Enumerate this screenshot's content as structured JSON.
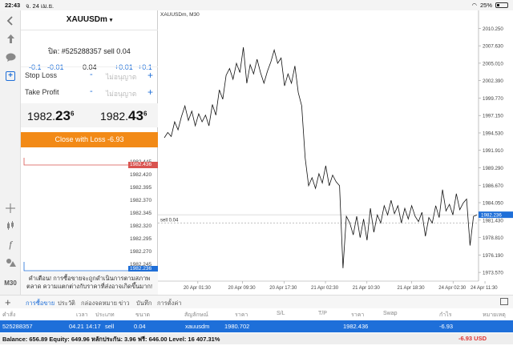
{
  "status": {
    "time": "22:43",
    "date": "จ. 24 เม.ย.",
    "battery": "25%"
  },
  "toolbar": {
    "tools": [
      "back-icon",
      "trade-icon",
      "chat-icon",
      "new-order-icon",
      "crosshair-icon",
      "candles-icon",
      "indicator-icon",
      "objects-icon",
      "timeframe"
    ],
    "timeframe": "M30",
    "indicator_glyph": "f"
  },
  "order": {
    "symbol": "XAUUSDm",
    "symbol_caret": "▾",
    "title": "ปิด: #525288357 sell 0.04",
    "steps": {
      "m2": "-0.1",
      "m1": "-0.01",
      "volume": "0.04",
      "p1": "+0.01",
      "p2": "+0.1"
    },
    "stop_loss": {
      "label": "Stop Loss",
      "minus": "-",
      "placeholder": "ไม่อนุญาต",
      "plus": "+"
    },
    "take_profit": {
      "label": "Take Profit",
      "minus": "-",
      "placeholder": "ไม่อนุญาต",
      "plus": "+"
    },
    "bid": {
      "main": "1982.",
      "big": "23",
      "sup": "6"
    },
    "ask": {
      "main": "1982.",
      "big": "43",
      "sup": "6"
    },
    "close_button": "Close with Loss -6.93",
    "warning": "คำเตือน! การซื้อขายจะถูกดำเนินการตามสภาพตลาด ความแตกต่างกับราคาที่ส่งอาจเกิดขึ้นมาก!"
  },
  "mini_chart": {
    "levels": [
      "1982.445",
      "1982.420",
      "1982.395",
      "1982.370",
      "1982.345",
      "1982.320",
      "1982.295",
      "1982.270",
      "1982.245"
    ],
    "ask_tag": "1982.436",
    "bid_tag": "1982.236",
    "ask_color": "#d9534f",
    "bid_color": "#1f6fd8"
  },
  "chart": {
    "title": "XAUUSDm, M30",
    "price_tag": "1982.236",
    "sell_label": "sell 0.04",
    "tag_color": "#1f6fd8"
  },
  "chart_data": {
    "type": "line",
    "title": "XAUUSDm, M30",
    "yticks": [
      "2010.250",
      "2007.630",
      "2005.010",
      "2002.390",
      "1999.770",
      "1997.150",
      "1994.530",
      "1991.910",
      "1989.290",
      "1986.670",
      "1984.050",
      "1981.430",
      "1978.810",
      "1976.190",
      "1973.570"
    ],
    "xticks": [
      "20 Apr 01:30",
      "20 Apr 09:30",
      "20 Apr 17:30",
      "21 Apr 02:30",
      "21 Apr 10:30",
      "21 Apr 18:30",
      "24 Apr 02:30",
      "24 Apr 11:30"
    ],
    "ylim": [
      1972.5,
      2011.5
    ],
    "sell_level": 1981.0,
    "current_price": 1982.236,
    "values": [
      1993.8,
      1994.6,
      1994.0,
      1996.2,
      1995.0,
      1997.0,
      1998.6,
      1996.4,
      1997.8,
      1995.6,
      1997.4,
      1996.2,
      1997.2,
      1995.6,
      1998.8,
      1997.2,
      2001.0,
      1999.6,
      2003.2,
      2004.2,
      2002.6,
      2005.0,
      2003.6,
      2007.4,
      2002.0,
      2004.8,
      2003.4,
      2005.6,
      2003.6,
      2002.0,
      2003.8,
      2005.2,
      2007.0,
      2005.0,
      2005.8,
      2001.6,
      2003.4,
      2002.0,
      2004.6,
      2000.6,
      1998.6,
      1990.8,
      1986.6,
      1987.8,
      1986.2,
      1988.4,
      1987.0,
      1989.6,
      1986.6,
      1988.2,
      1987.2,
      1986.6,
      1974.2,
      1982.0,
      1981.0,
      1979.2,
      1982.0,
      1978.8,
      1981.6,
      1978.4,
      1983.2,
      1979.6,
      1982.2,
      1981.0,
      1983.6,
      1982.2,
      1984.4,
      1982.4,
      1983.6,
      1981.0,
      1983.2,
      1981.6,
      1983.6,
      1982.0,
      1981.2,
      1982.6,
      1979.0,
      1981.8,
      1981.0,
      1983.6,
      1981.8,
      1986.0,
      1982.8,
      1983.8,
      1982.2,
      1985.4,
      1983.0,
      1984.0,
      1984.6,
      1977.6,
      1982.0,
      1982.2
    ]
  },
  "terminal": {
    "tabs": [
      "การซื้อขาย",
      "ประวัติ",
      "กล่องจดหมาย",
      "ข่าว",
      "บันทึก",
      "การตั้งค่า"
    ],
    "headers": [
      "คำสั่ง",
      "เวลา",
      "ประเภท",
      "ขนาด",
      "สัญลักษณ์",
      "ราคา",
      "S/L",
      "T/P",
      "ราคา",
      "Swap",
      "กำไร",
      "หมายเหตุ"
    ],
    "row": {
      "order": "525288357",
      "time": "04.21 14:17",
      "type": "sell",
      "size": "0.04",
      "symbol": "xauusdm",
      "open_price": "1980.702",
      "current_price": "1982.436",
      "profit": "-6.93"
    },
    "balance_line": "Balance: 656.89 Equity: 649.96 หลักประกัน: 3.96 ฟรี: 646.00 Level: 16 407.31%",
    "total_pl": "-6.93  USD"
  }
}
